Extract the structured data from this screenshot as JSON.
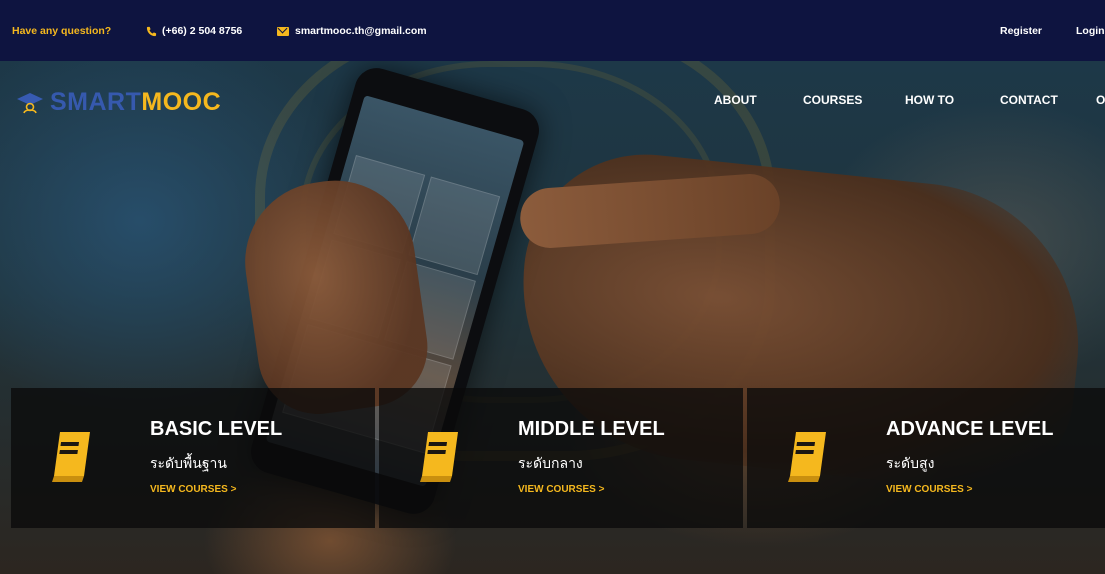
{
  "topbar": {
    "question": "Have any question?",
    "phone": "(+66) 2 504 8756",
    "email": "smartmooc.th@gmail.com",
    "register": "Register",
    "login": "Login"
  },
  "logo": {
    "part1": "SMART",
    "part2": "MOOC"
  },
  "nav": [
    "ABOUT",
    "COURSES",
    "HOW TO",
    "CONTACT",
    "O"
  ],
  "levels": [
    {
      "title": "BASIC LEVEL",
      "thai": "ระดับพื้นฐาน",
      "link": "VIEW COURSES >"
    },
    {
      "title": "MIDDLE LEVEL",
      "thai": "ระดับกลาง",
      "link": "VIEW COURSES >"
    },
    {
      "title": "ADVANCE LEVEL",
      "thai": "ระดับสูง",
      "link": "VIEW COURSES >"
    }
  ],
  "colors": {
    "topbar": "#0e1440",
    "accent": "#f5b81e",
    "logo_blue": "#3a5ebe"
  },
  "icons": {
    "phone": "phone-icon",
    "email": "email-icon",
    "book": "book-icon",
    "logo": "graduation-cap-icon"
  }
}
